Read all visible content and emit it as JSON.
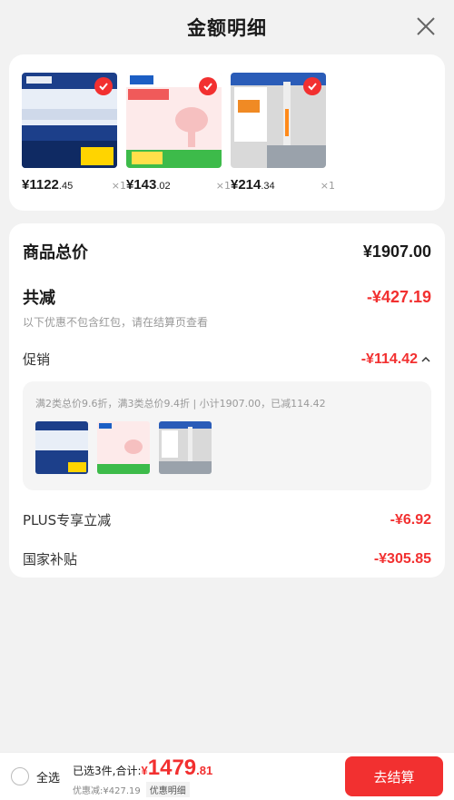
{
  "header": {
    "title": "金额明细"
  },
  "products": [
    {
      "price_int": "¥1122",
      "price_dec": ".45",
      "qty": "×1"
    },
    {
      "price_int": "¥143",
      "price_dec": ".02",
      "qty": "×1"
    },
    {
      "price_int": "¥214",
      "price_dec": ".34",
      "qty": "×1"
    }
  ],
  "summary": {
    "total_label": "商品总价",
    "total_value": "¥1907.00",
    "discount_label": "共减",
    "discount_value": "-¥427.19",
    "discount_note": "以下优惠不包含红包，请在结算页查看",
    "promo_label": "促销",
    "promo_value": "-¥114.42",
    "promo_detail": "满2类总价9.6折，满3类总价9.4折 | 小计1907.00，已减114.42",
    "plus_label": "PLUS专享立减",
    "plus_value": "-¥6.92",
    "gov_label": "国家补贴",
    "gov_value": "-¥305.85"
  },
  "bottom": {
    "select_all": "全选",
    "selected_text": "已选3件,合计:",
    "total_cur": "¥",
    "total_int": "1479",
    "total_dec": ".81",
    "saved_text": "优惠减:¥427.19",
    "detail_link": "优惠明细",
    "checkout": "去结算"
  },
  "colors": {
    "accent": "#f23030"
  }
}
